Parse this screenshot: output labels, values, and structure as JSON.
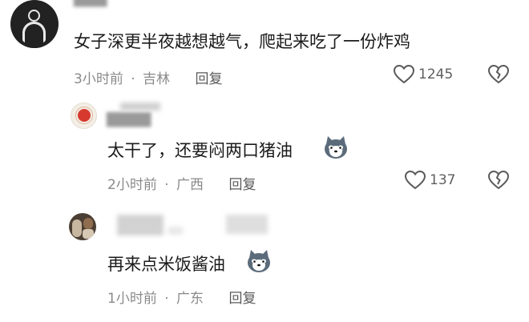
{
  "comments": [
    {
      "text": "女子深更半夜越想越气，爬起来吃了一份炸鸡",
      "time": "3小时前",
      "location": "吉林",
      "reply_label": "回复",
      "likes": "1245"
    },
    {
      "text": "太干了，还要闷两口猪油",
      "time": "2小时前",
      "location": "广西",
      "reply_label": "回复",
      "likes": "137"
    },
    {
      "text": "再来点米饭酱油",
      "time": "1小时前",
      "location": "广东",
      "reply_label": "回复"
    }
  ],
  "separator": "·",
  "icons": {
    "like": "heart-outline-icon",
    "dislike": "broken-heart-icon",
    "emoji": "husky-dog-emoji-icon"
  },
  "colors": {
    "text": "#1b1b1b",
    "meta": "#8a8a8a"
  }
}
